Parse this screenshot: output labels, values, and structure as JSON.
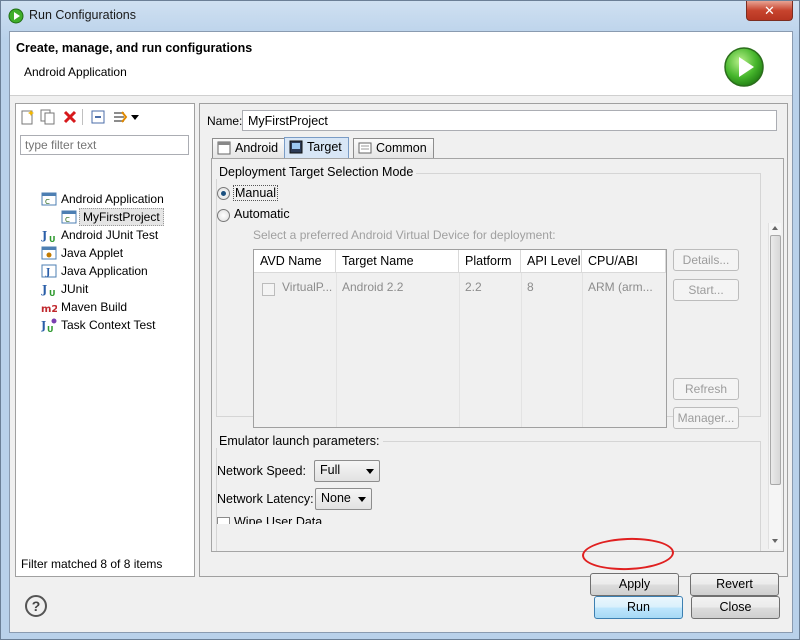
{
  "window": {
    "title": "Run Configurations",
    "close_label": "✕"
  },
  "banner": {
    "title": "Create, manage, and run configurations",
    "subtitle": "Android Application"
  },
  "left": {
    "filter_placeholder": "type filter text",
    "tree": [
      {
        "label": "Android Application",
        "icon": "android-app-icon"
      },
      {
        "label": "MyFirstProject",
        "icon": "android-app-icon",
        "selected": true
      },
      {
        "label": "Android JUnit Test",
        "icon": "junit-icon"
      },
      {
        "label": "Java Applet",
        "icon": "applet-icon"
      },
      {
        "label": "Java Application",
        "icon": "java-app-icon"
      },
      {
        "label": "JUnit",
        "icon": "junit-icon"
      },
      {
        "label": "Maven Build",
        "icon": "m2-icon"
      },
      {
        "label": "Task Context Test",
        "icon": "task-context-icon"
      }
    ],
    "status": "Filter matched 8 of 8 items"
  },
  "right": {
    "name_label": "Name:",
    "name_value": "MyFirstProject",
    "tabs": [
      {
        "label": "Android"
      },
      {
        "label": "Target",
        "active": true
      },
      {
        "label": "Common"
      }
    ],
    "deployment": {
      "group_title": "Deployment Target Selection Mode",
      "manual_label": "Manual",
      "automatic_label": "Automatic",
      "selected": "Manual",
      "hint": "Select a preferred Android Virtual Device for deployment:"
    },
    "avd_table": {
      "columns": [
        "AVD Name",
        "Target Name",
        "Platform",
        "API Level",
        "CPU/ABI"
      ],
      "rows": [
        {
          "name": "VirtualP...",
          "target": "Android 2.2",
          "platform": "2.2",
          "api": "8",
          "cpu": "ARM (arm..."
        }
      ]
    },
    "avd_buttons": {
      "details": "Details...",
      "start": "Start...",
      "refresh": "Refresh",
      "manager": "Manager..."
    },
    "emulator": {
      "group_title": "Emulator launch parameters:",
      "network_speed_label": "Network Speed:",
      "network_speed_value": "Full",
      "network_latency_label": "Network Latency:",
      "network_latency_value": "None",
      "wipe_label": "Wipe User Data"
    },
    "apply_label": "Apply",
    "revert_label": "Revert"
  },
  "footer": {
    "help_label": "?",
    "run_label": "Run",
    "close_label": "Close"
  },
  "colors": {
    "accent_highlight": "#e02020",
    "default_button": "#a7d9f5",
    "run_icon": "#3fae2a"
  }
}
